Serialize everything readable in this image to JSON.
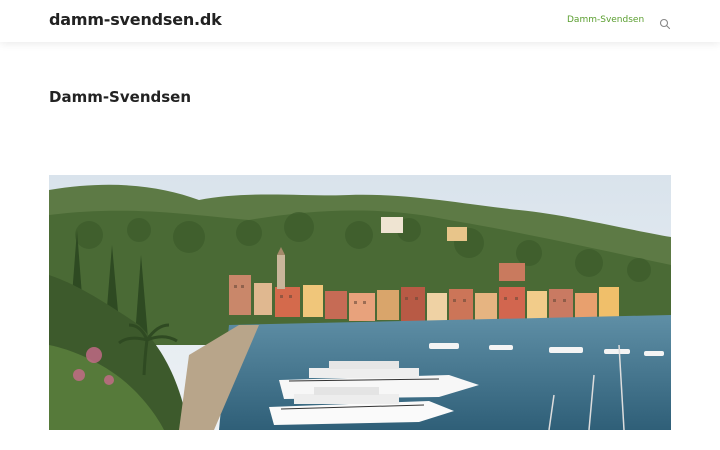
{
  "header": {
    "site_title": "damm-svendsen.dk",
    "nav": [
      {
        "label": "Damm-Svendsen"
      }
    ],
    "search_icon": "search-icon"
  },
  "main": {
    "page_title": "Damm-Svendsen",
    "hero_image": "harbor-photo"
  },
  "colors": {
    "nav_active": "#5a9e2f",
    "title": "#222222"
  }
}
